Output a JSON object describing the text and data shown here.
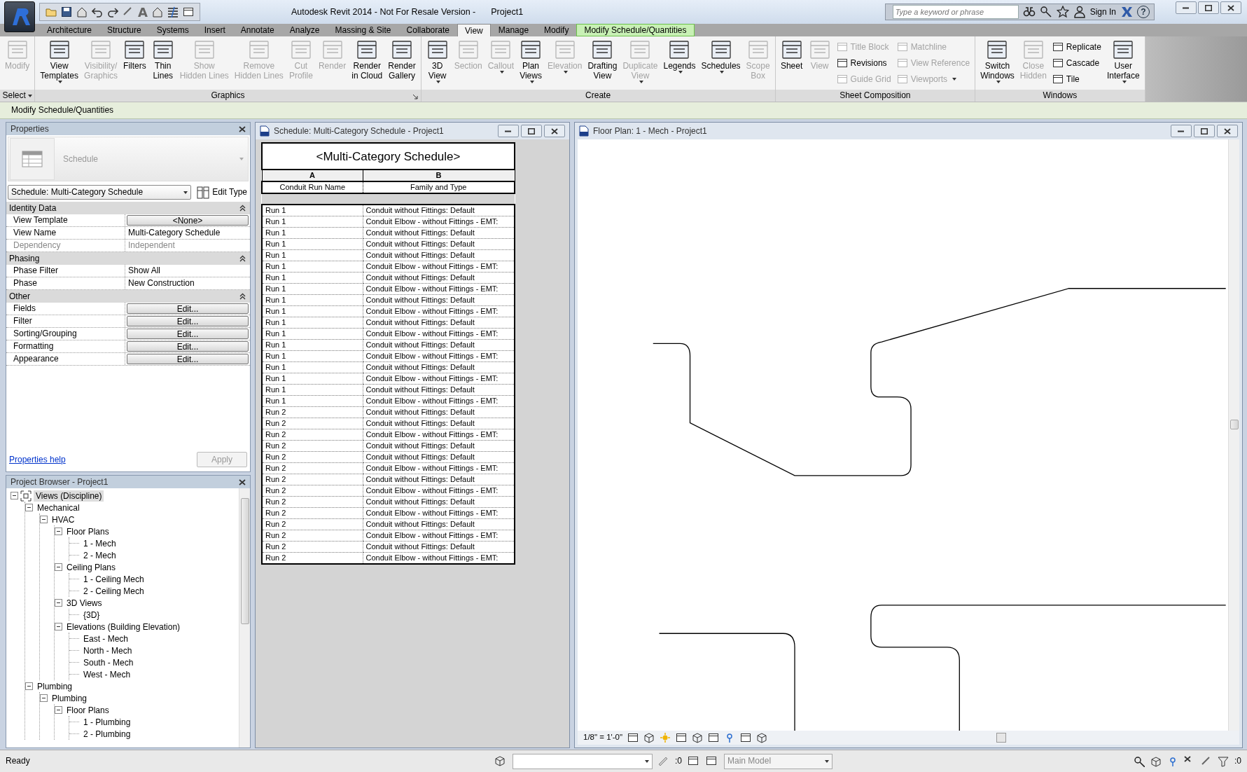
{
  "app": {
    "title": "Autodesk Revit 2014 - Not For Resale Version -",
    "project": "Project1",
    "quick_access_text": "A",
    "search_placeholder": "Type a keyword or phrase",
    "sign_in": "Sign In",
    "help": "?"
  },
  "ribbon": {
    "tabs": [
      {
        "label": "Architecture",
        "selected": false,
        "kind": "normal"
      },
      {
        "label": "Structure",
        "selected": false,
        "kind": "normal"
      },
      {
        "label": "Systems",
        "selected": false,
        "kind": "normal"
      },
      {
        "label": "Insert",
        "selected": false,
        "kind": "normal"
      },
      {
        "label": "Annotate",
        "selected": false,
        "kind": "normal"
      },
      {
        "label": "Analyze",
        "selected": false,
        "kind": "normal"
      },
      {
        "label": "Massing & Site",
        "selected": false,
        "kind": "normal"
      },
      {
        "label": "Collaborate",
        "selected": false,
        "kind": "normal"
      },
      {
        "label": "View",
        "selected": true,
        "kind": "normal"
      },
      {
        "label": "Manage",
        "selected": false,
        "kind": "normal"
      },
      {
        "label": "Modify",
        "selected": false,
        "kind": "normal"
      },
      {
        "label": "Modify Schedule/Quantities",
        "selected": false,
        "kind": "contextual"
      }
    ],
    "panels": [
      {
        "title": "Select",
        "title_dropdown": true,
        "launcher": false,
        "buttons": [
          {
            "label": [
              "Modify"
            ],
            "kind": "large",
            "disabled": true,
            "dropdown": false
          }
        ]
      },
      {
        "title": "Graphics",
        "title_dropdown": false,
        "launcher": true,
        "buttons": [
          {
            "label": [
              "View",
              "Templates"
            ],
            "kind": "large",
            "disabled": false,
            "dropdown": true
          },
          {
            "label": [
              "Visibility/",
              "Graphics"
            ],
            "kind": "large",
            "disabled": true,
            "dropdown": false
          },
          {
            "label": [
              "Filters"
            ],
            "kind": "large",
            "disabled": false,
            "dropdown": false
          },
          {
            "label": [
              "Thin",
              "Lines"
            ],
            "kind": "large",
            "disabled": false,
            "dropdown": false
          },
          {
            "label": [
              "Show",
              "Hidden Lines"
            ],
            "kind": "large",
            "disabled": true,
            "dropdown": false
          },
          {
            "label": [
              "Remove",
              "Hidden Lines"
            ],
            "kind": "large",
            "disabled": true,
            "dropdown": false
          },
          {
            "label": [
              "Cut",
              "Profile"
            ],
            "kind": "large",
            "disabled": true,
            "dropdown": false
          },
          {
            "label": [
              "Render"
            ],
            "kind": "large",
            "disabled": true,
            "dropdown": false
          },
          {
            "label": [
              "Render",
              "in Cloud"
            ],
            "kind": "large",
            "disabled": false,
            "dropdown": false
          },
          {
            "label": [
              "Render",
              "Gallery"
            ],
            "kind": "large",
            "disabled": false,
            "dropdown": false
          }
        ]
      },
      {
        "title": "Create",
        "title_dropdown": false,
        "launcher": false,
        "buttons": [
          {
            "label": [
              "3D",
              "View"
            ],
            "kind": "large",
            "disabled": false,
            "dropdown": true
          },
          {
            "label": [
              "Section"
            ],
            "kind": "large",
            "disabled": true,
            "dropdown": false
          },
          {
            "label": [
              "Callout"
            ],
            "kind": "large",
            "disabled": true,
            "dropdown": true
          },
          {
            "label": [
              "Plan",
              "Views"
            ],
            "kind": "large",
            "disabled": false,
            "dropdown": true
          },
          {
            "label": [
              "Elevation"
            ],
            "kind": "large",
            "disabled": true,
            "dropdown": true
          },
          {
            "label": [
              "Drafting",
              "View"
            ],
            "kind": "large",
            "disabled": false,
            "dropdown": false
          },
          {
            "label": [
              "Duplicate",
              "View"
            ],
            "kind": "large",
            "disabled": true,
            "dropdown": true
          },
          {
            "label": [
              "Legends"
            ],
            "kind": "large",
            "disabled": false,
            "dropdown": true
          },
          {
            "label": [
              "Schedules"
            ],
            "kind": "large",
            "disabled": false,
            "dropdown": true
          },
          {
            "label": [
              "Scope",
              "Box"
            ],
            "kind": "large",
            "disabled": true,
            "dropdown": false
          }
        ]
      },
      {
        "title": "Sheet Composition",
        "title_dropdown": false,
        "launcher": false,
        "buttons": [
          {
            "label": [
              "Sheet"
            ],
            "kind": "large",
            "disabled": false,
            "dropdown": false
          },
          {
            "label": [
              "View"
            ],
            "kind": "large",
            "disabled": true,
            "dropdown": false
          },
          {
            "label": [
              "Title Block"
            ],
            "kind": "small",
            "disabled": true,
            "dropdown": false
          },
          {
            "label": [
              "Revisions"
            ],
            "kind": "small",
            "disabled": false,
            "dropdown": false
          },
          {
            "label": [
              "Guide Grid"
            ],
            "kind": "small",
            "disabled": true,
            "dropdown": false
          },
          {
            "label": [
              "Matchline"
            ],
            "kind": "small",
            "disabled": true,
            "dropdown": false
          },
          {
            "label": [
              "View Reference"
            ],
            "kind": "small",
            "disabled": true,
            "dropdown": false
          },
          {
            "label": [
              "Viewports"
            ],
            "kind": "small",
            "disabled": true,
            "dropdown": true
          }
        ]
      },
      {
        "title": "Windows",
        "title_dropdown": false,
        "launcher": false,
        "buttons": [
          {
            "label": [
              "Switch",
              "Windows"
            ],
            "kind": "large",
            "disabled": false,
            "dropdown": true
          },
          {
            "label": [
              "Close",
              "Hidden"
            ],
            "kind": "large",
            "disabled": true,
            "dropdown": false
          },
          {
            "label": [
              "Replicate"
            ],
            "kind": "small",
            "disabled": false,
            "dropdown": false
          },
          {
            "label": [
              "Cascade"
            ],
            "kind": "small",
            "disabled": false,
            "dropdown": false
          },
          {
            "label": [
              "Tile"
            ],
            "kind": "small",
            "disabled": false,
            "dropdown": false
          },
          {
            "label": [
              "User",
              "Interface"
            ],
            "kind": "large",
            "disabled": false,
            "dropdown": true
          }
        ]
      }
    ]
  },
  "context_bar": "Modify Schedule/Quantities",
  "properties": {
    "title": "Properties",
    "type_name": "Schedule",
    "instance": "Schedule: Multi-Category Schedule",
    "edit_type": "Edit Type",
    "groups": [
      {
        "name": "Identity Data",
        "rows": [
          {
            "label": "View Template",
            "value": "<None>",
            "kind": "button",
            "disabled": false
          },
          {
            "label": "View Name",
            "value": "Multi-Category Schedule",
            "kind": "text",
            "disabled": false
          },
          {
            "label": "Dependency",
            "value": "Independent",
            "kind": "text",
            "disabled": true
          }
        ]
      },
      {
        "name": "Phasing",
        "rows": [
          {
            "label": "Phase Filter",
            "value": "Show All",
            "kind": "text",
            "disabled": false
          },
          {
            "label": "Phase",
            "value": "New Construction",
            "kind": "text",
            "disabled": false
          }
        ]
      },
      {
        "name": "Other",
        "rows": [
          {
            "label": "Fields",
            "value": "Edit...",
            "kind": "button",
            "disabled": false
          },
          {
            "label": "Filter",
            "value": "Edit...",
            "kind": "button",
            "disabled": false
          },
          {
            "label": "Sorting/Grouping",
            "value": "Edit...",
            "kind": "button",
            "disabled": false
          },
          {
            "label": "Formatting",
            "value": "Edit...",
            "kind": "button",
            "disabled": false
          },
          {
            "label": "Appearance",
            "value": "Edit...",
            "kind": "button",
            "disabled": false
          }
        ]
      }
    ],
    "help_link": "Properties help",
    "apply": {
      "label": "Apply",
      "disabled": true
    }
  },
  "browser": {
    "title": "Project Browser - Project1",
    "tree": [
      {
        "label": "Views (Discipline)",
        "selected": true,
        "expanded": true,
        "children": [
          {
            "label": "Mechanical",
            "selected": false,
            "expanded": true,
            "children": [
              {
                "label": "HVAC",
                "selected": false,
                "expanded": true,
                "children": [
                  {
                    "label": "Floor Plans",
                    "selected": false,
                    "expanded": true,
                    "children": [
                      {
                        "label": "1 - Mech",
                        "selected": false
                      },
                      {
                        "label": "2 - Mech",
                        "selected": false
                      }
                    ]
                  },
                  {
                    "label": "Ceiling Plans",
                    "selected": false,
                    "expanded": true,
                    "children": [
                      {
                        "label": "1 - Ceiling Mech",
                        "selected": false
                      },
                      {
                        "label": "2 - Ceiling Mech",
                        "selected": false
                      }
                    ]
                  },
                  {
                    "label": "3D Views",
                    "selected": false,
                    "expanded": true,
                    "children": [
                      {
                        "label": "{3D}",
                        "selected": false
                      }
                    ]
                  },
                  {
                    "label": "Elevations (Building Elevation)",
                    "selected": false,
                    "expanded": true,
                    "children": [
                      {
                        "label": "East - Mech",
                        "selected": false
                      },
                      {
                        "label": "North - Mech",
                        "selected": false
                      },
                      {
                        "label": "South - Mech",
                        "selected": false
                      },
                      {
                        "label": "West - Mech",
                        "selected": false
                      }
                    ]
                  }
                ]
              }
            ]
          },
          {
            "label": "Plumbing",
            "selected": false,
            "expanded": true,
            "children": [
              {
                "label": "Plumbing",
                "selected": false,
                "expanded": true,
                "children": [
                  {
                    "label": "Floor Plans",
                    "selected": false,
                    "expanded": true,
                    "children": [
                      {
                        "label": "1 - Plumbing",
                        "selected": false
                      },
                      {
                        "label": "2 - Plumbing",
                        "selected": false
                      }
                    ]
                  }
                ]
              }
            ]
          }
        ]
      }
    ]
  },
  "schedule_window": {
    "title": "Schedule: Multi-Category Schedule - Project1",
    "heading": "<Multi-Category Schedule>",
    "columns": [
      {
        "letter": "A",
        "heading": "Conduit Run Name"
      },
      {
        "letter": "B",
        "heading": "Family and Type"
      }
    ],
    "rows": [
      [
        "Run 1",
        "Conduit without Fittings: Default"
      ],
      [
        "Run 1",
        "Conduit Elbow - without Fittings - EMT:"
      ],
      [
        "Run 1",
        "Conduit without Fittings: Default"
      ],
      [
        "Run 1",
        "Conduit without Fittings: Default"
      ],
      [
        "Run 1",
        "Conduit without Fittings: Default"
      ],
      [
        "Run 1",
        "Conduit Elbow - without Fittings - EMT:"
      ],
      [
        "Run 1",
        "Conduit without Fittings: Default"
      ],
      [
        "Run 1",
        "Conduit Elbow - without Fittings - EMT:"
      ],
      [
        "Run 1",
        "Conduit without Fittings: Default"
      ],
      [
        "Run 1",
        "Conduit Elbow - without Fittings - EMT:"
      ],
      [
        "Run 1",
        "Conduit without Fittings: Default"
      ],
      [
        "Run 1",
        "Conduit Elbow - without Fittings - EMT:"
      ],
      [
        "Run 1",
        "Conduit without Fittings: Default"
      ],
      [
        "Run 1",
        "Conduit Elbow - without Fittings - EMT:"
      ],
      [
        "Run 1",
        "Conduit without Fittings: Default"
      ],
      [
        "Run 1",
        "Conduit Elbow - without Fittings - EMT:"
      ],
      [
        "Run 1",
        "Conduit without Fittings: Default"
      ],
      [
        "Run 1",
        "Conduit Elbow - without Fittings - EMT:"
      ],
      [
        "Run 2",
        "Conduit without Fittings: Default"
      ],
      [
        "Run 2",
        "Conduit without Fittings: Default"
      ],
      [
        "Run 2",
        "Conduit Elbow - without Fittings - EMT:"
      ],
      [
        "Run 2",
        "Conduit without Fittings: Default"
      ],
      [
        "Run 2",
        "Conduit without Fittings: Default"
      ],
      [
        "Run 2",
        "Conduit Elbow - without Fittings - EMT:"
      ],
      [
        "Run 2",
        "Conduit without Fittings: Default"
      ],
      [
        "Run 2",
        "Conduit Elbow - without Fittings - EMT:"
      ],
      [
        "Run 2",
        "Conduit without Fittings: Default"
      ],
      [
        "Run 2",
        "Conduit Elbow - without Fittings - EMT:"
      ],
      [
        "Run 2",
        "Conduit without Fittings: Default"
      ],
      [
        "Run 2",
        "Conduit Elbow - without Fittings - EMT:"
      ],
      [
        "Run 2",
        "Conduit without Fittings: Default"
      ],
      [
        "Run 2",
        "Conduit Elbow - without Fittings - EMT:"
      ]
    ]
  },
  "plan_window": {
    "title": "Floor Plan: 1 - Mech - Project1",
    "scale": "1/8\" = 1'-0\""
  },
  "status_bar": {
    "message": "Ready",
    "count": ":0",
    "model": "Main Model",
    "filter_count": ":0"
  }
}
